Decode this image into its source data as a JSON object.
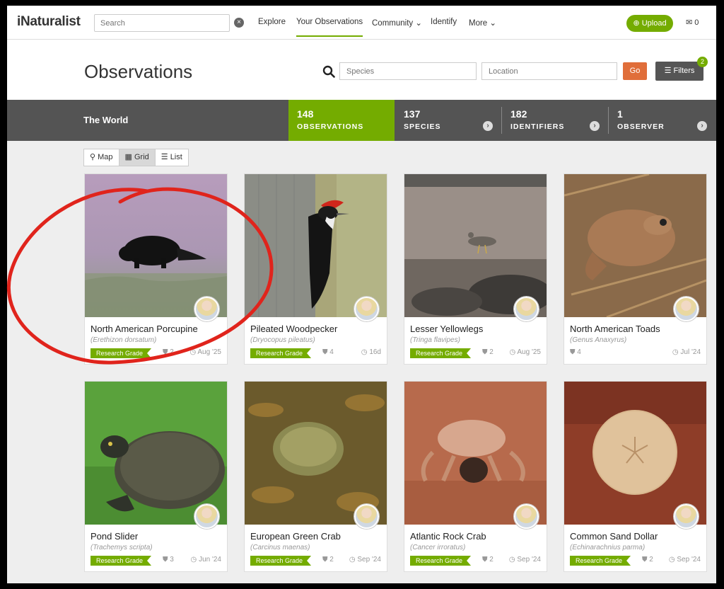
{
  "nav": {
    "logo": "iNaturalist",
    "search_placeholder": "Search",
    "links": [
      "Explore",
      "Your Observations",
      "Community ⌄",
      "Identify",
      "More ⌄"
    ],
    "upload": "Upload",
    "mail_count": "0"
  },
  "header": {
    "title": "Observations",
    "species_placeholder": "Species",
    "location_placeholder": "Location",
    "go": "Go",
    "filters": "Filters",
    "filters_badge": "2"
  },
  "stats": {
    "place": "The World",
    "items": [
      {
        "num": "148",
        "label": "OBSERVATIONS"
      },
      {
        "num": "137",
        "label": "SPECIES"
      },
      {
        "num": "182",
        "label": "IDENTIFIERS"
      },
      {
        "num": "1",
        "label": "OBSERVER"
      }
    ]
  },
  "views": [
    "Map",
    "Grid",
    "List"
  ],
  "cards": [
    {
      "name": "North American Porcupine",
      "sci": "(Erethizon dorsatum)",
      "grade": "Research Grade",
      "ids": "2",
      "date": "Aug '25"
    },
    {
      "name": "Pileated Woodpecker",
      "sci": "(Dryocopus pileatus)",
      "grade": "Research Grade",
      "ids": "4",
      "date": "16d"
    },
    {
      "name": "Lesser Yellowlegs",
      "sci": "(Tringa flavipes)",
      "grade": "Research Grade",
      "ids": "2",
      "date": "Aug '25"
    },
    {
      "name": "North American Toads",
      "sci": "(Genus Anaxyrus)",
      "grade": "",
      "ids": "4",
      "date": "Jul '24"
    },
    {
      "name": "Pond Slider",
      "sci": "(Trachemys scripta)",
      "grade": "Research Grade",
      "ids": "3",
      "date": "Jun '24"
    },
    {
      "name": "European Green Crab",
      "sci": "(Carcinus maenas)",
      "grade": "Research Grade",
      "ids": "2",
      "date": "Sep '24"
    },
    {
      "name": "Atlantic Rock Crab",
      "sci": "(Cancer irroratus)",
      "grade": "Research Grade",
      "ids": "2",
      "date": "Sep '24"
    },
    {
      "name": "Common Sand Dollar",
      "sci": "(Echinarachnius parma)",
      "grade": "Research Grade",
      "ids": "2",
      "date": "Sep '24"
    }
  ]
}
